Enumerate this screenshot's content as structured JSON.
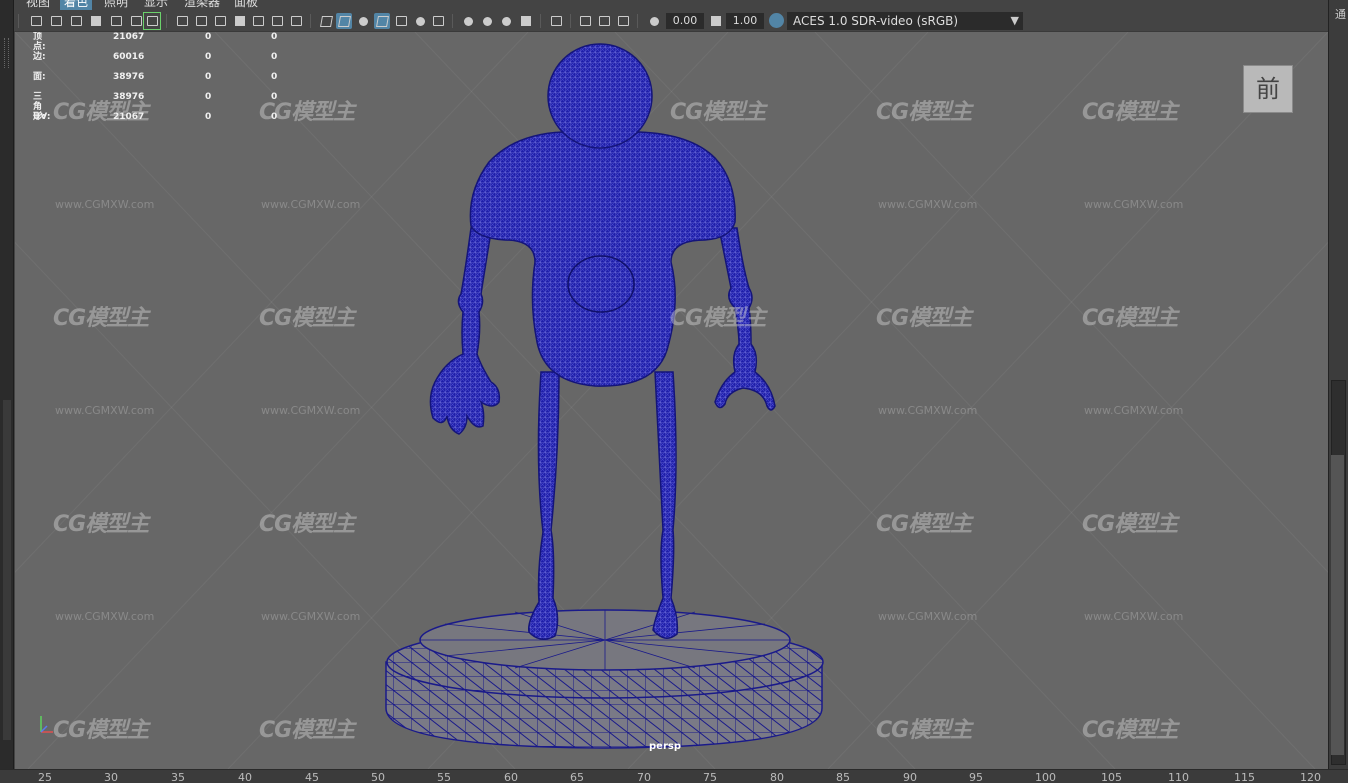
{
  "menu": [
    "视图",
    "着色",
    "照明",
    "显示",
    "渲染器",
    "面板"
  ],
  "toolbar": {
    "exposure_value": "0.00",
    "gamma_value": "1.00",
    "color_space": "ACES 1.0 SDR-video (sRGB)"
  },
  "hud": {
    "rows": [
      {
        "label": "顶点:",
        "v1": "21067",
        "v2": "0",
        "v3": "0"
      },
      {
        "label": "边:",
        "v1": "60016",
        "v2": "0",
        "v3": "0"
      },
      {
        "label": "面:",
        "v1": "38976",
        "v2": "0",
        "v3": "0"
      },
      {
        "label": "三角形:",
        "v1": "38976",
        "v2": "0",
        "v3": "0"
      },
      {
        "label": "UV:",
        "v1": "21067",
        "v2": "0",
        "v3": "0"
      }
    ]
  },
  "viewcube_label": "前",
  "camera_label": "persp",
  "watermark": {
    "logo": "CG模型主",
    "url": "www.CGMXW.com"
  },
  "timeline_ticks": [
    "25",
    "30",
    "35",
    "40",
    "45",
    "50",
    "55",
    "60",
    "65",
    "70",
    "75",
    "80",
    "85",
    "90",
    "95",
    "100",
    "105",
    "110",
    "115",
    "120"
  ],
  "right_panel_char": "通",
  "colors": {
    "mesh": "#1a1a9a",
    "viewport_bg": "#676767",
    "accent": "#5285a6"
  }
}
